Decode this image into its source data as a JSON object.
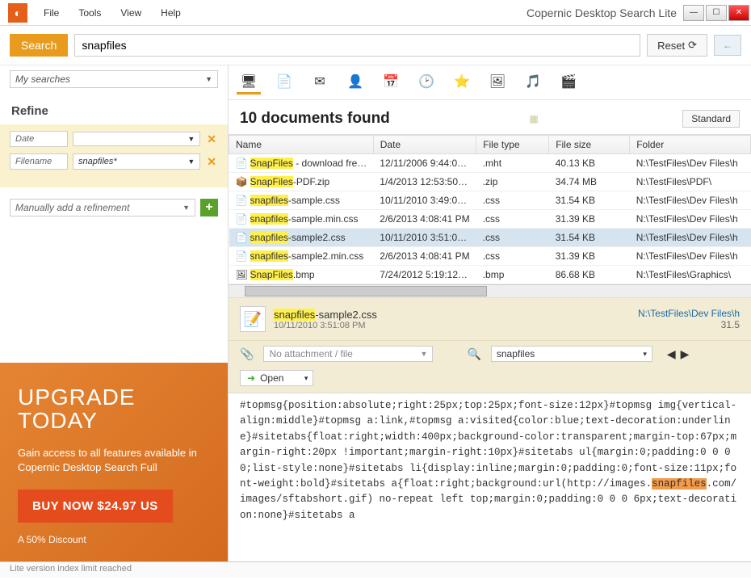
{
  "app": {
    "title": "Copernic Desktop Search Lite"
  },
  "menu": [
    "File",
    "Tools",
    "View",
    "Help"
  ],
  "search": {
    "label": "Search",
    "value": "snapfiles",
    "reset": "Reset"
  },
  "mysearches": "My searches",
  "refine": {
    "heading": "Refine",
    "rows": [
      {
        "label": "Date",
        "value": ""
      },
      {
        "label": "Filename",
        "value": "snapfiles*"
      }
    ],
    "add": "Manually add a refinement"
  },
  "upgrade": {
    "h1": "UPGRADE",
    "h2": "TODAY",
    "text": "Gain access to all features available in Copernic Desktop Search Full",
    "buy": "BUY NOW  $24.97 US",
    "discount": "A 50% Discount"
  },
  "results": {
    "title": "10 documents found",
    "view": "Standard",
    "columns": [
      "Name",
      "Date",
      "File type",
      "File size",
      "Folder"
    ],
    "rows": [
      {
        "icon": "📄",
        "name_hl": "SnapFiles",
        "name_rest": " - download fre…",
        "date": "12/11/2006 9:44:0…",
        "type": ".mht",
        "size": "40.13 KB",
        "folder": "N:\\TestFiles\\Dev Files\\h"
      },
      {
        "icon": "📦",
        "name_hl": "SnapFiles",
        "name_rest": "-PDF.zip",
        "date": "1/4/2013 12:53:50…",
        "type": ".zip",
        "size": "34.74 MB",
        "folder": "N:\\TestFiles\\PDF\\"
      },
      {
        "icon": "📄",
        "name_hl": "snapfiles",
        "name_rest": "-sample.css",
        "date": "10/11/2010 3:49:0…",
        "type": ".css",
        "size": "31.54 KB",
        "folder": "N:\\TestFiles\\Dev Files\\h"
      },
      {
        "icon": "📄",
        "name_hl": "snapfiles",
        "name_rest": "-sample.min.css",
        "date": "2/6/2013 4:08:41 PM",
        "type": ".css",
        "size": "31.39 KB",
        "folder": "N:\\TestFiles\\Dev Files\\h"
      },
      {
        "icon": "📄",
        "name_hl": "snapfiles",
        "name_rest": "-sample2.css",
        "date": "10/11/2010 3:51:0…",
        "type": ".css",
        "size": "31.54 KB",
        "folder": "N:\\TestFiles\\Dev Files\\h",
        "sel": true
      },
      {
        "icon": "📄",
        "name_hl": "snapfiles",
        "name_rest": "-sample2.min.css",
        "date": "2/6/2013 4:08:41 PM",
        "type": ".css",
        "size": "31.39 KB",
        "folder": "N:\\TestFiles\\Dev Files\\h"
      },
      {
        "icon": "🖼",
        "name_hl": "SnapFiles",
        "name_rest": ".bmp",
        "date": "7/24/2012 5:19:12…",
        "type": ".bmp",
        "size": "86.68 KB",
        "folder": "N:\\TestFiles\\Graphics\\"
      }
    ]
  },
  "preview": {
    "name_hl": "snapfiles",
    "name_rest": "-sample2.css",
    "date": "10/11/2010 3:51:08 PM",
    "path": "N:\\TestFiles\\Dev Files\\h",
    "size": "31.5",
    "attachment": "No attachment / file",
    "searchvalue": "snapfiles",
    "open": "Open",
    "body_pre": "#topmsg{position:absolute;right:25px;top:25px;font-size:12px}#topmsg img{vertical-align:middle}#topmsg a:link,#topmsg a:visited{color:blue;text-decoration:underline}#sitetabs{float:right;width:400px;background-color:transparent;margin-top:67px;margin-right:20px !important;margin-right:10px}#sitetabs ul{margin:0;padding:0 0 0 0;list-style:none}#sitetabs li{display:inline;margin:0;padding:0;font-size:11px;font-weight:bold}#sitetabs a{float:right;background:url(http://images.",
    "body_kw": "snapfiles",
    "body_post": ".com/images/sftabshort.gif) no-repeat left top;margin:0;padding:0 0 0 6px;text-decoration:none}#sitetabs a"
  },
  "status": "Lite version index limit reached"
}
